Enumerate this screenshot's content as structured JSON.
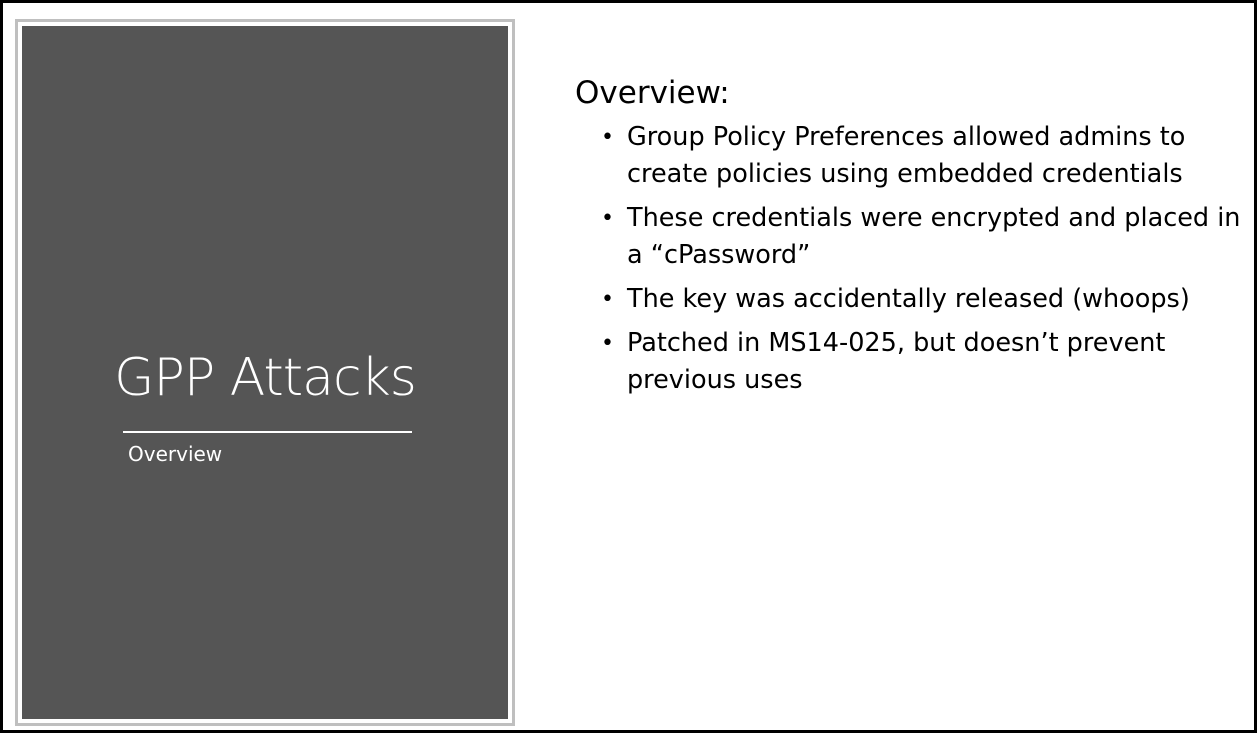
{
  "title_panel": {
    "title": "GPP Attacks",
    "subtitle": "Overview"
  },
  "content": {
    "heading": "Overview:",
    "bullets": [
      "Group Policy Preferences allowed admins to create policies using embedded credentials",
      "These credentials were encrypted and placed in a “cPassword”",
      "The key was accidentally released (whoops)",
      "Patched in MS14-025, but doesn’t prevent previous uses"
    ]
  },
  "colors": {
    "panel_background": "#555555",
    "panel_border": "#bfbfbf",
    "slide_border": "#000000",
    "title_text": "#ffffff"
  }
}
